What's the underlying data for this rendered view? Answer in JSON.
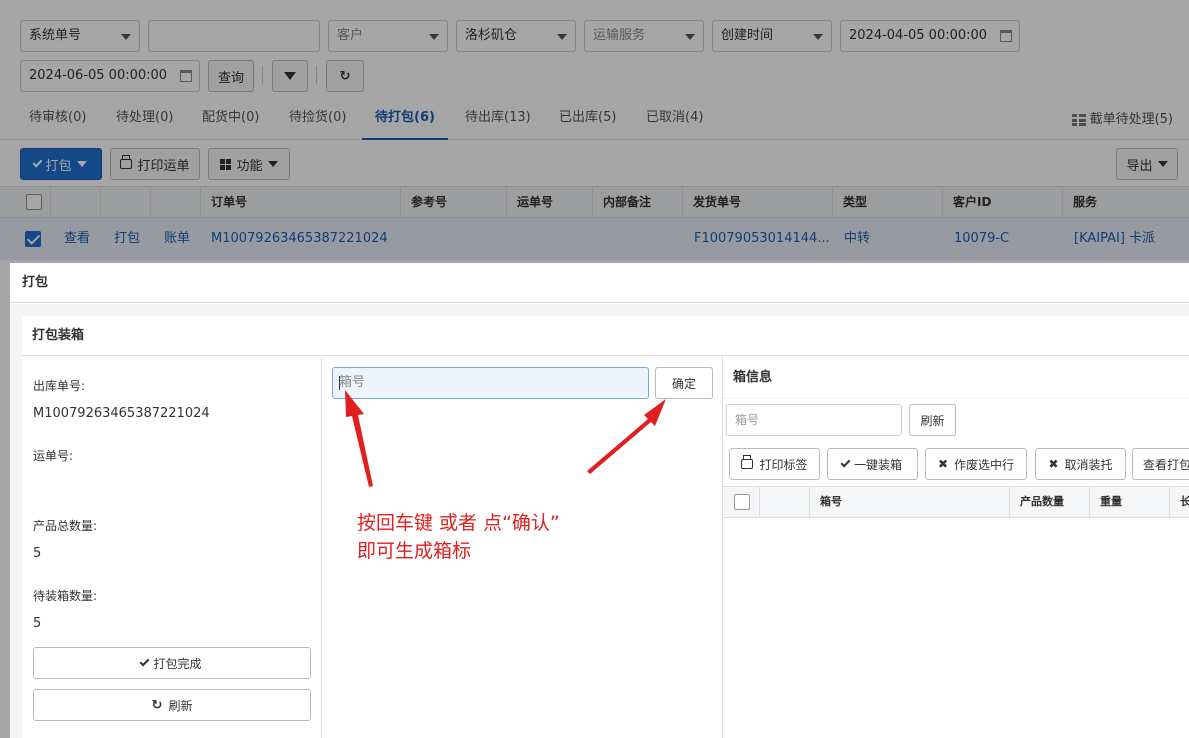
{
  "filters": {
    "system_no": "系统单号",
    "blank_value": "",
    "customer": "客户",
    "warehouse": "洛杉矶仓",
    "shipping_service": "运输服务",
    "time_field": "创建时间",
    "start_time": "2024-04-05 00:00:00",
    "end_time": "2024-06-05 00:00:00",
    "query_label": "查询"
  },
  "tabs": [
    {
      "label": "待审核(0)"
    },
    {
      "label": "待处理(0)"
    },
    {
      "label": "配货中(0)"
    },
    {
      "label": "待捡货(0)"
    },
    {
      "label": "待打包(6)"
    },
    {
      "label": "待出库(13)"
    },
    {
      "label": "已出库(5)"
    },
    {
      "label": "已取消(4)"
    }
  ],
  "active_tab": "待打包(6)",
  "tab_right": "截单待处理(5)",
  "toolbar": {
    "pack_label": "打包",
    "print_waybill_label": "打印运单",
    "function_label": "功能",
    "export_label": "导出"
  },
  "table": {
    "headers": [
      "订单号",
      "参考号",
      "运单号",
      "内部备注",
      "发货单号",
      "类型",
      "客户ID",
      "服务"
    ],
    "row": {
      "view": "查看",
      "pack": "打包",
      "bill": "账单",
      "order_no": "M10079263465387221024",
      "ship_no": "F10079053014144...",
      "type": "中转",
      "customer_id": "10079-C",
      "service": "[KAIPAI] 卡派"
    }
  },
  "modal": {
    "title": "打包",
    "panel_title": "打包装箱",
    "outbound_label": "出库单号:",
    "outbound_value": "M10079263465387221024",
    "waybill_label": "运单号:",
    "total_qty_label": "产品总数量:",
    "total_qty_value": "5",
    "pending_qty_label": "待装箱数量:",
    "pending_qty_value": "5",
    "finish_button": "打包完成",
    "refresh_button": "刷新",
    "box_placeholder": "箱号",
    "confirm_button": "确定",
    "annotation_line1": "按回车键    或者   点“确认”",
    "annotation_line2": "即可生成箱标",
    "box_info_title": "箱信息",
    "box_search_placeholder": "箱号",
    "box_refresh": "刷新",
    "btn_print_label": "打印标签",
    "btn_one_click": "一键装箱",
    "btn_void": "作废选中行",
    "btn_cancel_pack": "取消装托",
    "btn_view_print": "查看打包",
    "box_table_headers": [
      "箱号",
      "产品数量",
      "重量",
      "长"
    ]
  },
  "colors": {
    "primary": "#1f6fd1",
    "link": "#1a5fb4",
    "annotation": "#e02020"
  }
}
